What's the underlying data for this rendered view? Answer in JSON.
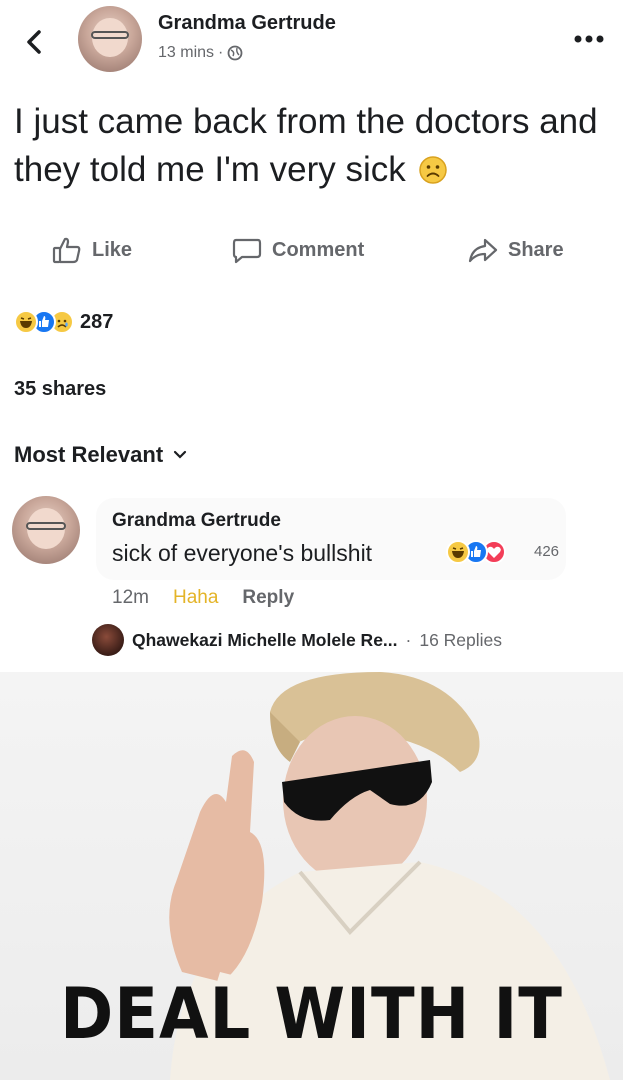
{
  "post": {
    "back_icon": "chevron-left-icon",
    "author": "Grandma Gertrude",
    "time": "13 mins",
    "separator": "·",
    "privacy_icon": "globe-icon",
    "more_icon": "more-horizontal-icon",
    "text": "I just came back from the doctors and they told me I'm very sick",
    "emoji": "sad-face-emoji"
  },
  "actions": {
    "like_label": "Like",
    "comment_label": "Comment",
    "share_label": "Share"
  },
  "reactions": {
    "icons": [
      "haha-icon",
      "like-icon",
      "sad-icon"
    ],
    "count": "287",
    "shares": "35 shares"
  },
  "comments": {
    "sort_label": "Most Relevant",
    "sort_icon": "chevron-down-icon",
    "items": [
      {
        "author": "Grandma Gertrude",
        "text": "sick of everyone's bullshit",
        "reaction_icons": [
          "haha-icon",
          "like-icon",
          "love-icon"
        ],
        "reaction_count": "426",
        "time": "12m",
        "reaction_label": "Haha",
        "reply_label": "Reply",
        "reply_preview": {
          "author": "Qhawekazi Michelle Molele Re...",
          "separator": "·",
          "count": "16 Replies"
        }
      }
    ]
  },
  "meme": {
    "caption": "DEAL WITH IT"
  },
  "colors": {
    "text": "#1c1e21",
    "muted": "#65676b",
    "haha": "#e4b428",
    "like": "#1877f2",
    "love": "#f33e58"
  }
}
